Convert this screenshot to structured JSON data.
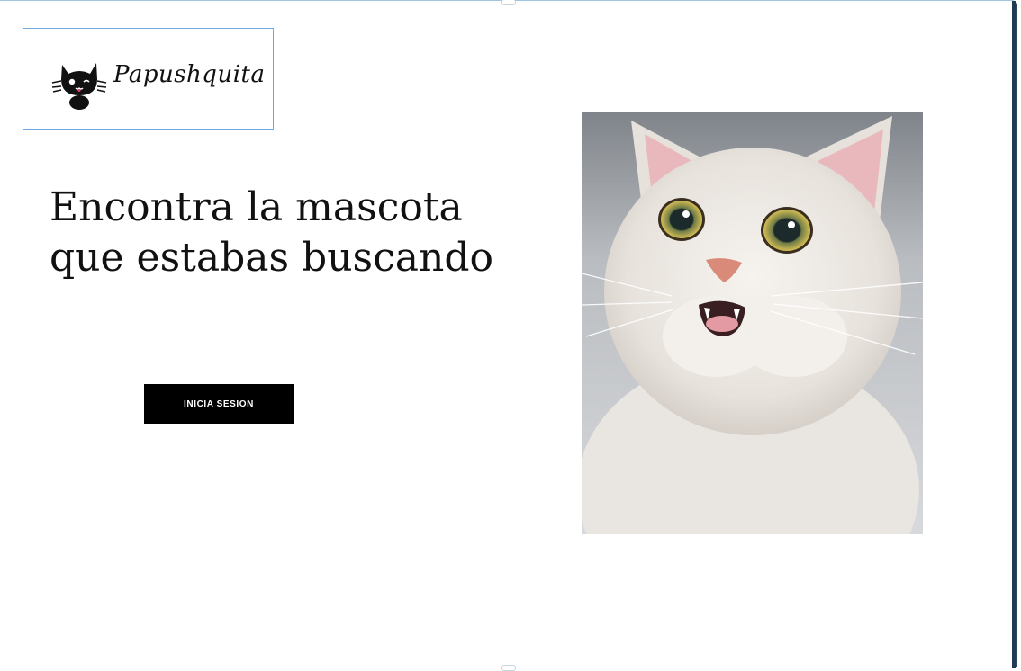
{
  "brand": {
    "name": "Papushquita",
    "logo_icon": "cat-face-icon"
  },
  "hero": {
    "headline_line1": "Encontra la mascota",
    "headline_line2": "que estabas buscando",
    "login_label": "INICIA SESION"
  },
  "photo": {
    "subject": "cat-photo",
    "colors": {
      "background": "#8a8f96",
      "fur": "#ece8e3",
      "eye_iris": "#c9b24a",
      "nose": "#d98a78"
    }
  }
}
